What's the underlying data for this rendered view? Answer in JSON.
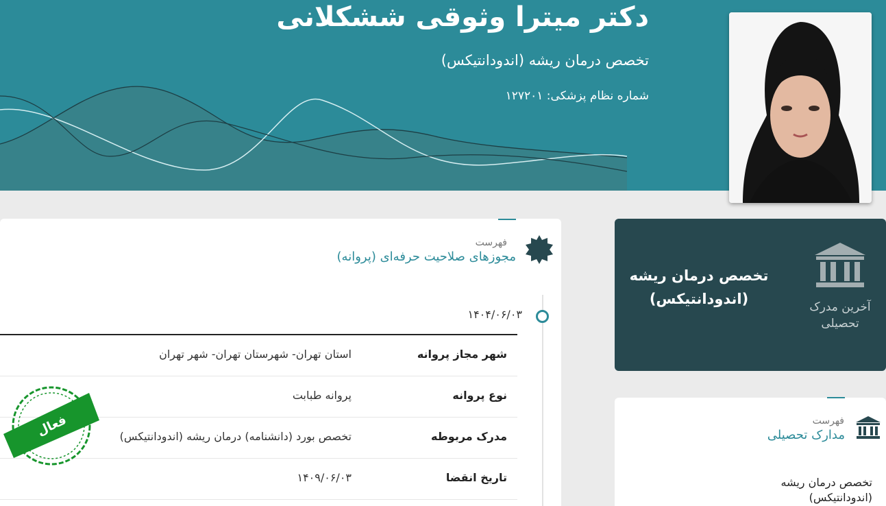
{
  "doctor": {
    "name": "دکتر میترا وثوقی ششکلانی",
    "specialty": "تخصص درمان ریشه (اندودانتیکس)",
    "registration": "شماره نظام پزشکی: ۱۲۷۲۰۱"
  },
  "education_summary": {
    "title": "تخصص درمان ریشه (اندودانتیکس)",
    "latest_label": "آخرین مدرک تحصیلی",
    "icon": "bank-icon"
  },
  "licenses": {
    "list_label": "فهرست",
    "title": "مجوزهای صلاحیت حرفه‌ای (پروانه)",
    "entry": {
      "date": "۱۴۰۴/۰۶/۰۳",
      "rows": [
        {
          "label": "شهر مجاز پروانه",
          "value": "استان تهران- شهرستان تهران- شهر تهران"
        },
        {
          "label": "نوع پروانه",
          "value": "پروانه طبابت"
        },
        {
          "label": "مدرک مربوطه",
          "value": "تخصص بورد (دانشنامه) درمان ریشه (اندودانتیکس)"
        },
        {
          "label": "تاریخ انقضا",
          "value": "۱۴۰۹/۰۶/۰۳"
        }
      ],
      "status": "فعال",
      "status_color": "#17952c"
    }
  },
  "education_list": {
    "list_label": "فهرست",
    "title": "مدارک تحصیلی",
    "entry": "تخصص درمان ریشه (اندودانتیکس)"
  },
  "colors": {
    "header": "#2c8b99",
    "edu_card": "#27484f",
    "accent": "#2c8b99"
  }
}
